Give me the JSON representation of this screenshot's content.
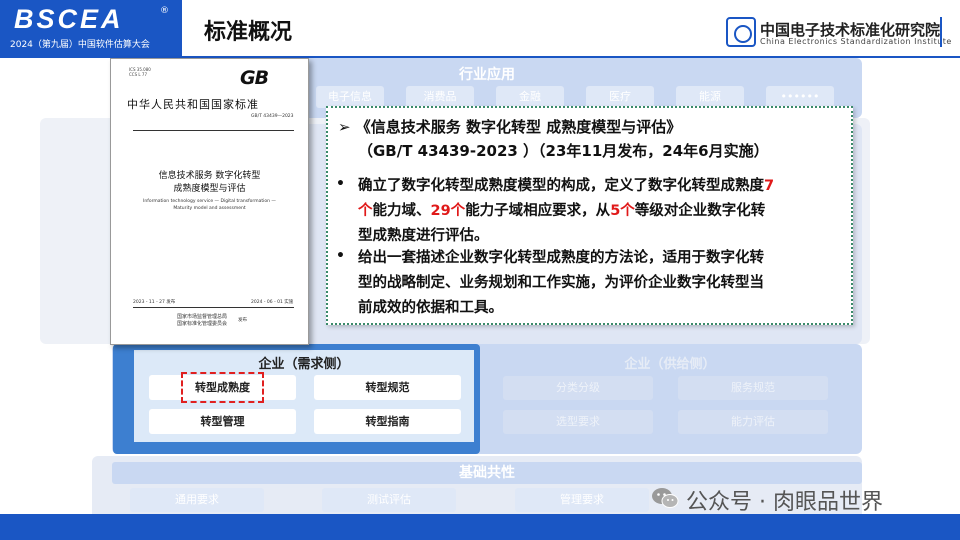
{
  "header": {
    "logo": "BSCEA",
    "logo_mark": "®",
    "logo_subtitle": "2024（第九届）中国软件估算大会",
    "title": "标准概况",
    "org_cn": "中国电子技术标准化研究院",
    "org_en": "China Electronics Standardization Institute"
  },
  "diagram": {
    "industry": {
      "title": "行业应用",
      "items": [
        "电子信息",
        "消费品",
        "金融",
        "医疗",
        "能源",
        "••••••"
      ]
    },
    "enterprise_demand": {
      "title": "企业（需求侧）",
      "items": [
        "转型成熟度",
        "转型规范",
        "转型管理",
        "转型指南"
      ]
    },
    "enterprise_supply": {
      "title": "企业（供给侧）",
      "items": [
        "分类分级",
        "服务规范",
        "选型要求",
        "能力评估"
      ]
    },
    "foundation": {
      "title": "基础共性",
      "items": [
        "通用要求",
        "测试评估",
        "管理要求"
      ]
    }
  },
  "document": {
    "meta": "ICS 35.080\nCCS L 77",
    "gb_logo": "GB",
    "heading": "中华人民共和国国家标准",
    "number": "GB/T 43439—2023",
    "title_line1": "信息技术服务  数字化转型",
    "title_line2": "成熟度模型与评估",
    "en_line1": "Information technology service — Digital transformation —",
    "en_line2": "Maturity model and assessment",
    "release_date": "2023 - 11 - 27 发布",
    "effective_date": "2024 - 06 - 01 实施",
    "publisher1": "国家市场监督管理总局",
    "publisher2": "国家标准化管理委员会",
    "publish_suffix": "发布"
  },
  "info": {
    "heading1": "➢ 《信息技术服务 数字化转型 成熟度模型与评估》",
    "heading2": "（GB/T 43439-2023 ）（23年11月发布，24年6月实施）",
    "bullet_char": "•",
    "b1_l1_a": "确立了数字化转型成熟度模型的构成，定义了数字化转型成熟度",
    "b1_l1_red": "7",
    "b1_l2_red1": "个",
    "b1_l2_a": "能力域、",
    "b1_l2_red2": "29个",
    "b1_l2_b": "能力子域相应要求，从",
    "b1_l2_red3": "5个",
    "b1_l2_c": "等级对企业数字化转",
    "b1_l3": "型成熟度进行评估。",
    "b2_l1": "给出一套描述企业数字化转型成熟度的方法论，适用于数字化转",
    "b2_l2": "型的战略制定、业务规划和工作实施，为评价企业数字化转型当",
    "b2_l3": "前成效的依据和工具。"
  },
  "watermark": {
    "text": "公众号 · 肉眼品世界"
  }
}
